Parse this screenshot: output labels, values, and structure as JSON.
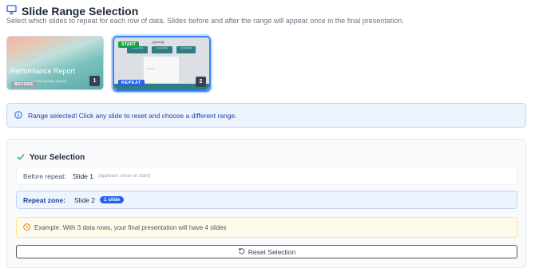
{
  "header": {
    "title": "Slide Range Selection",
    "icon": "monitor-icon"
  },
  "subtitle": "Select which slides to repeat for each row of data. Slides before and after the range will appear once in the final presentation.",
  "slides": [
    {
      "title": "Performance Report",
      "subtitle": "Monthly Update | {{date}}",
      "badge": "BEFORE",
      "number": "1"
    },
    {
      "header_text": "{{client}}",
      "boxes": [
        "{{metric1}}",
        "{{metric2}}",
        "{{metric3}}"
      ],
      "body_text": "{{notes}}",
      "start_badge": "START",
      "repeat_badge": "REPEAT",
      "number": "2"
    }
  ],
  "info": {
    "message": "Range selected! Click any slide to reset and choose a different range."
  },
  "selection": {
    "title": "Your Selection",
    "before_label": "Before repeat:",
    "before_value": "Slide 1",
    "before_note": "(appears once at start)",
    "repeat_label": "Repeat zone:",
    "repeat_value": "Slide 2",
    "repeat_badge": "1 slide",
    "example": "Example: With 3 data rows, your final presentation will have 4 slides",
    "reset_label": "Reset Selection"
  },
  "colors": {
    "accent": "#2563eb",
    "start": "#16a34a",
    "info_bg": "#eef4fe",
    "warn_bg": "#fffbeb"
  }
}
